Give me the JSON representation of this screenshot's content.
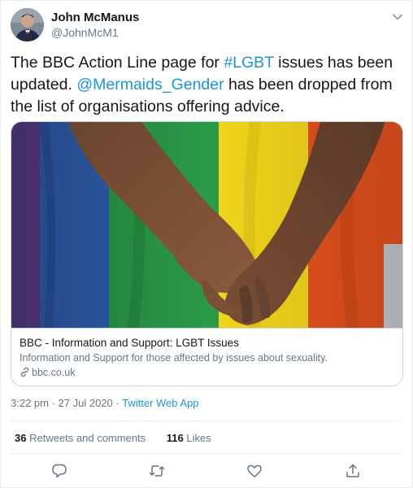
{
  "author": {
    "name": "John McManus",
    "handle": "@JohnMcM1"
  },
  "tweet": {
    "part1": "The BBC Action Line page for ",
    "hashtag": "#LGBT",
    "part2": " issues has been updated. ",
    "mention": "@Mermaids_Gender",
    "part3": " has been dropped from the list of organisations offering advice."
  },
  "card": {
    "title": "BBC - Information and Support: LGBT Issues",
    "description": "Information and Support for those affected by issues about sexuality.",
    "domain": "bbc.co.uk"
  },
  "meta": {
    "time": "3:22 pm",
    "separator": " · ",
    "date": "27 Jul 2020",
    "app": "Twitter Web App"
  },
  "stats": {
    "retweets_count": "36",
    "retweets_label": "Retweets and comments",
    "likes_count": "116",
    "likes_label": "Likes"
  },
  "icons": {
    "reply": "reply-icon",
    "retweet": "retweet-icon",
    "like": "heart-icon",
    "share": "share-icon",
    "menu": "chevron-down-icon",
    "link": "link-icon"
  },
  "colors": {
    "accent": "#1b95e0",
    "secondary_text": "#657786",
    "border": "#e6ecf0"
  }
}
